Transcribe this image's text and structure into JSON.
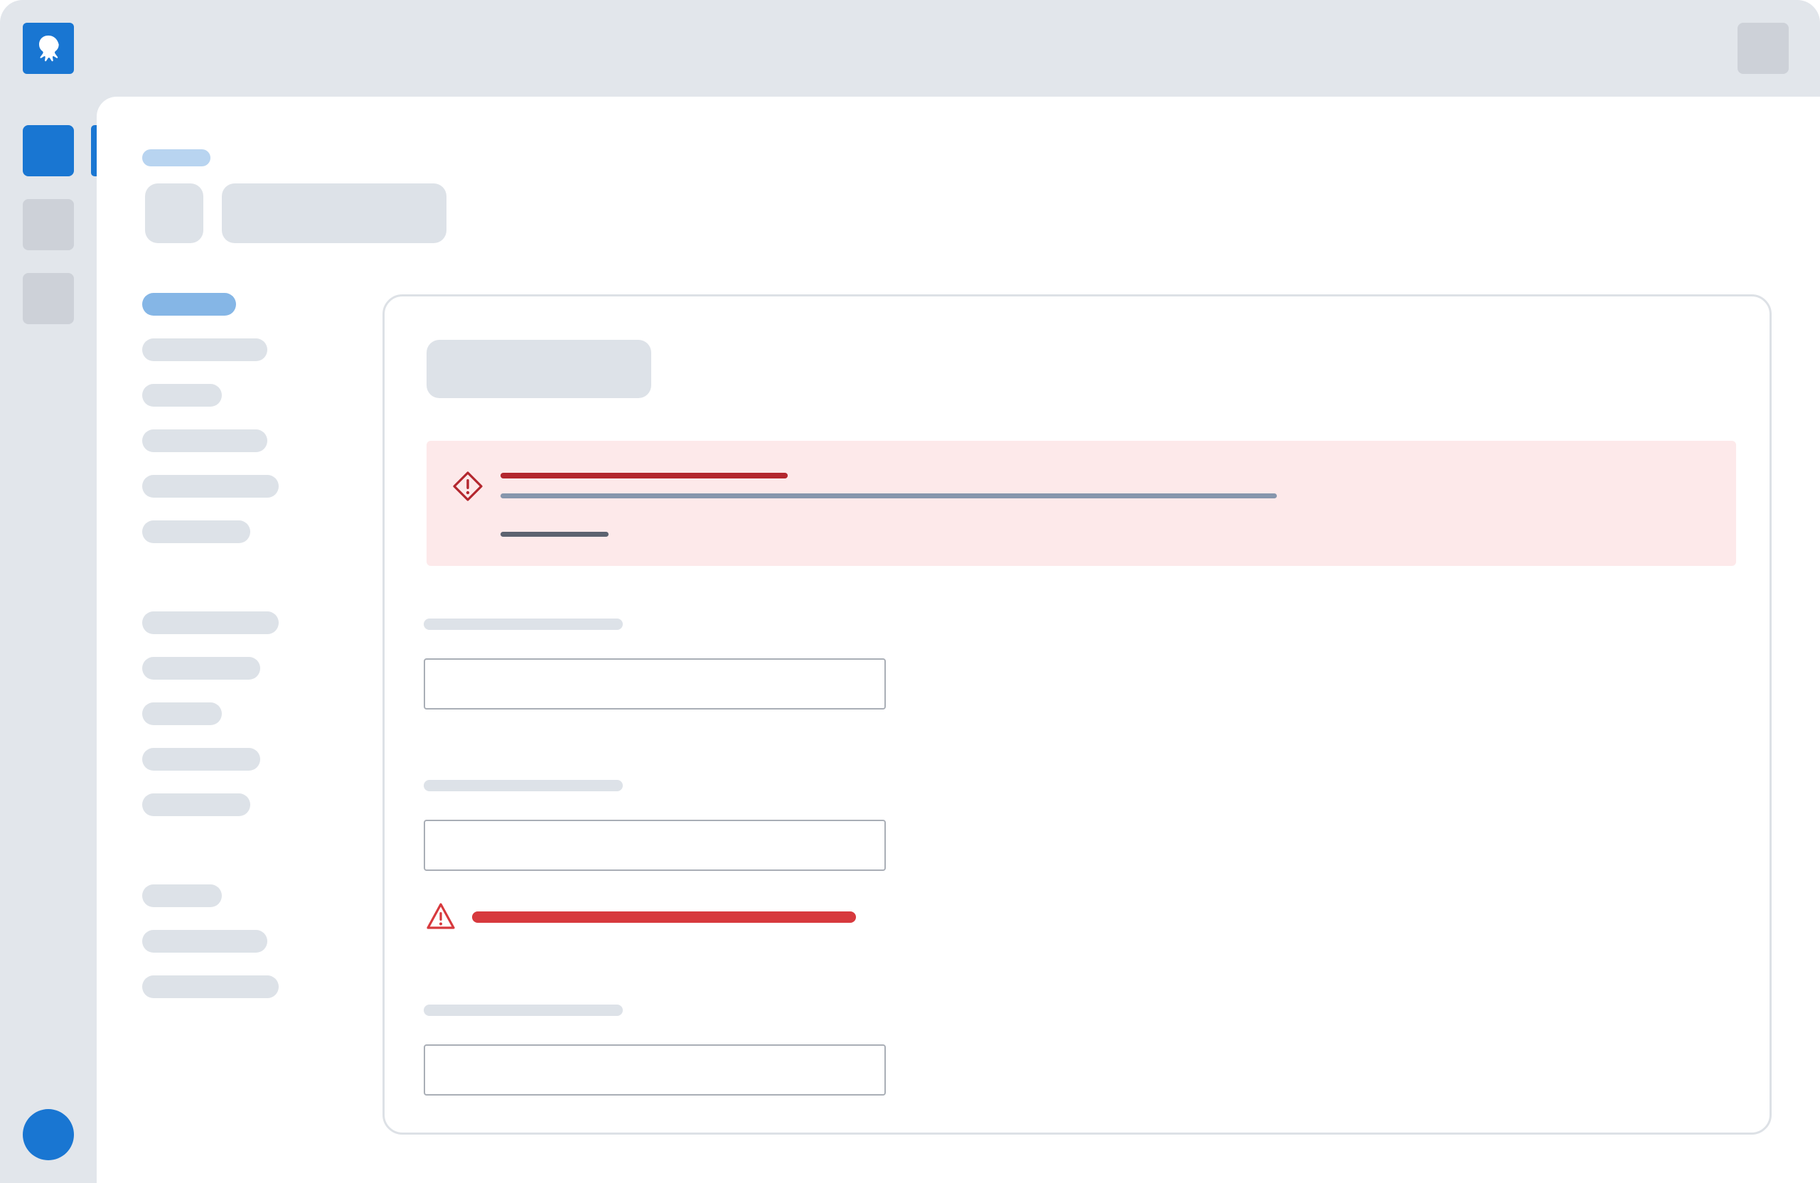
{
  "colors": {
    "frame_bg": "#e2e6eb",
    "brand_blue": "#1976d2",
    "rail_inactive": "#cdd1d8",
    "skeleton": "#dde2e8",
    "skeleton_light": "#b8d4f0",
    "skeleton_active": "#85b6e6",
    "alert_bg": "#fde9ea",
    "alert_red": "#b3262e",
    "alert_secondary": "#8796ad",
    "alert_tertiary": "#5c6270",
    "error_red": "#d7393d"
  },
  "icons": {
    "logo": "octopus-logo-icon",
    "alert": "diamond-warning-icon",
    "field_error": "triangle-warning-icon"
  },
  "nav": {
    "groups": [
      {
        "items": [
          {
            "state": "active"
          },
          {
            "state": "idle"
          },
          {
            "state": "idle"
          },
          {
            "state": "idle"
          },
          {
            "state": "idle"
          },
          {
            "state": "idle"
          }
        ]
      },
      {
        "items": [
          {
            "state": "idle"
          },
          {
            "state": "idle"
          },
          {
            "state": "idle"
          },
          {
            "state": "idle"
          },
          {
            "state": "idle"
          }
        ]
      },
      {
        "items": [
          {
            "state": "idle"
          },
          {
            "state": "idle"
          },
          {
            "state": "idle"
          }
        ]
      }
    ]
  },
  "form": {
    "fields": [
      {
        "value": "",
        "has_error": false
      },
      {
        "value": "",
        "has_error": true
      },
      {
        "value": "",
        "has_error": false
      }
    ]
  }
}
